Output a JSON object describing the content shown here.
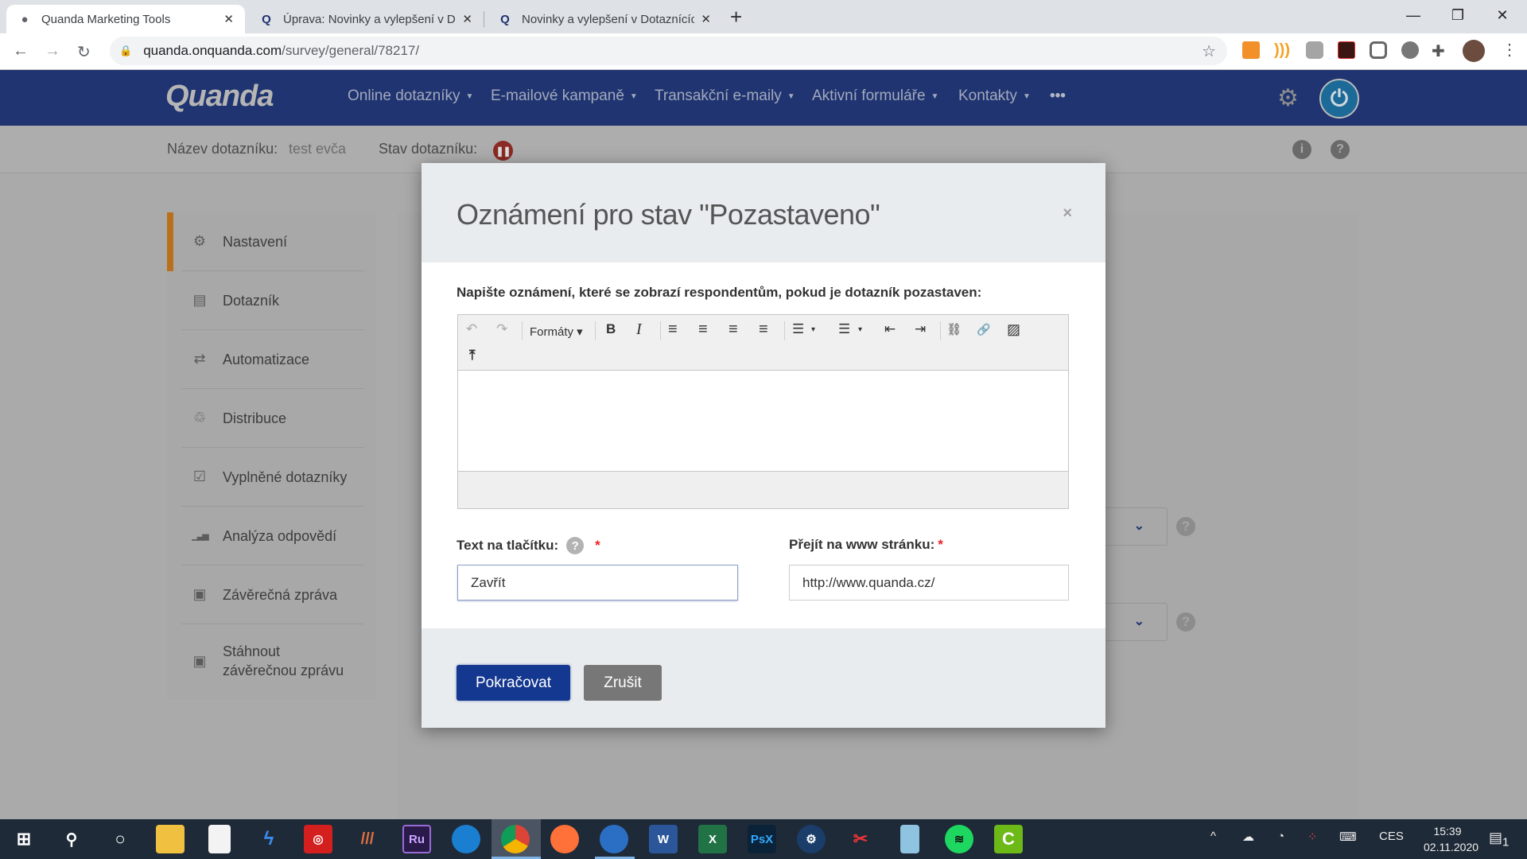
{
  "browser": {
    "tabs": [
      {
        "title": "Quanda Marketing Tools",
        "active": true,
        "icon": "globe-icon"
      },
      {
        "title": "Úprava: Novinky a vylepšení v Dotaznících",
        "active": false,
        "icon": "quanda-favicon"
      },
      {
        "title": "Novinky a vylepšení v Dotaznících",
        "active": false,
        "icon": "quanda-favicon"
      }
    ],
    "new_tab": "+",
    "url_host": "quanda.onquanda.com",
    "url_path": "/survey/general/78217/",
    "window_controls": {
      "minimize": "—",
      "maximize": "❐",
      "close": "✕"
    },
    "extensions": [
      "analytics-extension",
      "rss-extension",
      "camera-extension",
      "acrobat-extension",
      "pocket-extension",
      "circle-extension",
      "extensions-puzzle",
      "profile-avatar",
      "menu-kebab"
    ]
  },
  "app": {
    "logo": "Quanda",
    "menu": [
      {
        "label": "Online dotazníky"
      },
      {
        "label": "E-mailové kampaně"
      },
      {
        "label": "Transakční e-maily"
      },
      {
        "label": "Aktivní formuláře"
      },
      {
        "label": "Kontakty"
      }
    ],
    "more": "•••",
    "survey_name_label": "Název dotazníku:",
    "survey_name": "test evča",
    "survey_state_label": "Stav dotazníku:",
    "survey_state": "paused",
    "info_icon": "i",
    "help_icon": "?"
  },
  "sidebar": {
    "items": [
      {
        "label": "Nastavení",
        "icon": "gear-icon",
        "glyph": "⚙",
        "active": true
      },
      {
        "label": "Dotazník",
        "icon": "document-icon",
        "glyph": "▤"
      },
      {
        "label": "Automatizace",
        "icon": "repeat-icon",
        "glyph": "⇄"
      },
      {
        "label": "Distribuce",
        "icon": "share-icon",
        "glyph": "♲"
      },
      {
        "label": "Vyplněné dotazníky",
        "icon": "checked-doc-icon",
        "glyph": "☑"
      },
      {
        "label": "Analýza odpovědí",
        "icon": "bar-chart-icon",
        "glyph": "▁▃▅"
      },
      {
        "label": "Závěrečná zpráva",
        "icon": "report-icon",
        "glyph": "▣"
      },
      {
        "label": "Stáhnout závěrečnou zprávu",
        "icon": "download-report-icon",
        "glyph": "▣"
      }
    ]
  },
  "modal": {
    "title": "Oznámení pro stav \"Pozastaveno\"",
    "close": "×",
    "prompt": "Napište oznámení, které se zobrazí respondentům, pokud je dotazník pozastaven:",
    "toolbar": {
      "undo": "↶",
      "redo": "↷",
      "formats": "Formáty ▾",
      "bold": "B",
      "italic": "I",
      "align_left": "≡",
      "align_center": "≡",
      "align_right": "≡",
      "justify": "≡",
      "bullet_list": "☰",
      "numbered_list": "☰",
      "list_caret": "▾",
      "outdent": "⇤",
      "indent": "⇥",
      "unlink": "⛓",
      "link": "🔗",
      "image": "▨",
      "insert": "⤒"
    },
    "editor_content": "",
    "button_text_label": "Text na tlačítku:",
    "button_text_value": "Zavřít",
    "url_label": "Přejít na www stránku:",
    "url_value": "http://www.quanda.cz/",
    "required_mark": "*",
    "help": "?",
    "continue": "Pokračovat",
    "cancel": "Zrušit"
  },
  "colors": {
    "nav_bg": "#1f3470",
    "primary_button": "#14378f",
    "cancel_button": "#777777",
    "accent_active": "#b8701d",
    "paused_status": "#8a2a24"
  },
  "taskbar": {
    "apps": [
      "windows-start",
      "search",
      "cortana",
      "file-explorer",
      "ms-store",
      "app-blue",
      "creative-cloud",
      "app-stripes",
      "adobe-rush",
      "edge",
      "chrome",
      "firefox",
      "thunderbird",
      "word",
      "excel",
      "photoshop-express",
      "steam",
      "snipping-tool",
      "notepad",
      "spotify",
      "camtasia"
    ],
    "language": "CES",
    "time": "15:39",
    "date": "02.11.2020",
    "notifications": "1"
  }
}
